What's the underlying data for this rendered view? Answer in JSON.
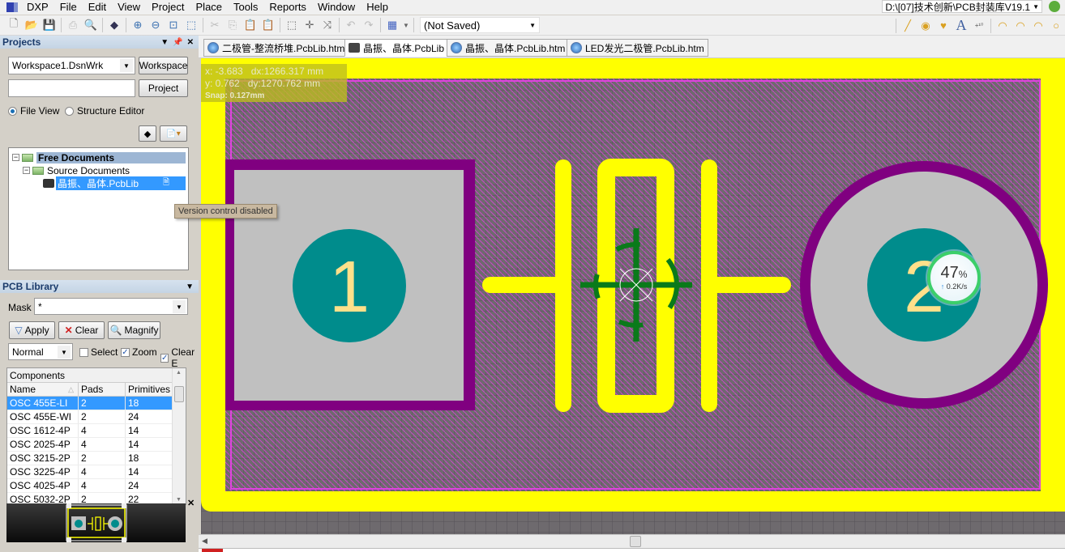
{
  "menubar": {
    "app": "DXP",
    "items": [
      "File",
      "Edit",
      "View",
      "Project",
      "Place",
      "Tools",
      "Reports",
      "Window",
      "Help"
    ],
    "path": "D:\\[07]技术创新\\PCB封装库V19.1"
  },
  "toolbar": {
    "layer_select": "(Not Saved)",
    "icons_left": [
      "new-doc",
      "open-folder",
      "save",
      "print",
      "print-preview",
      "3d-view",
      "zoom-in",
      "zoom-out",
      "zoom-fit",
      "zoom-area",
      "cut",
      "copy",
      "paste",
      "paste-special",
      "select-area",
      "move",
      "cross-probe",
      "undo",
      "redo",
      "grid"
    ],
    "icons_right": [
      "line",
      "pad",
      "via",
      "string",
      "coordinate",
      "arc-center",
      "arc-edge",
      "arc-any",
      "full-circle"
    ]
  },
  "projects_panel": {
    "title": "Projects",
    "workspace_value": "Workspace1.DsnWrk",
    "workspace_btn": "Workspace",
    "project_value": "",
    "project_btn": "Project",
    "view_options": [
      "File View",
      "Structure Editor"
    ],
    "selected_view": "File View",
    "tree": {
      "root": "Free Documents",
      "child": "Source Documents",
      "file": "晶振、晶体.PcbLib"
    },
    "tooltip": "Version control disabled"
  },
  "pcb_library": {
    "title": "PCB Library",
    "mask_label": "Mask",
    "mask_value": "*",
    "apply": "Apply",
    "clear": "Clear",
    "magnify": "Magnify",
    "mode": "Normal",
    "select_label": "Select",
    "zoom_label": "Zoom",
    "clear_existing_label": "Clear E",
    "select_checked": false,
    "zoom_checked": true,
    "clear_existing_checked": true,
    "components_title": "Components",
    "columns": [
      "Name",
      "Pads",
      "Primitives"
    ],
    "rows": [
      {
        "name": "OSC 455E-LI",
        "pads": "2",
        "prims": "18"
      },
      {
        "name": "OSC 455E-WI",
        "pads": "2",
        "prims": "24"
      },
      {
        "name": "OSC 1612-4P",
        "pads": "4",
        "prims": "14"
      },
      {
        "name": "OSC 2025-4P",
        "pads": "4",
        "prims": "14"
      },
      {
        "name": "OSC 3215-2P",
        "pads": "2",
        "prims": "18"
      },
      {
        "name": "OSC 3225-4P",
        "pads": "4",
        "prims": "14"
      },
      {
        "name": "OSC 4025-4P",
        "pads": "4",
        "prims": "24"
      },
      {
        "name": "OSC 5032-2P",
        "pads": "2",
        "prims": "22"
      }
    ],
    "selected_index": 0
  },
  "tabs": [
    {
      "label": "二极管-整流桥堆.PcbLib.htm",
      "icon": "ie"
    },
    {
      "label": "晶振、晶体.PcbLib",
      "icon": "lib",
      "active": true
    },
    {
      "label": "晶振、晶体.PcbLib.htm",
      "icon": "ie"
    },
    {
      "label": "LED发光二极管.PcbLib.htm",
      "icon": "ie"
    }
  ],
  "coords": {
    "x": "x: -3.683",
    "dx": "dx:1266.317 mm",
    "y": "y:  0.762",
    "dy": "dy:1270.762 mm",
    "snap": "Snap: 0.127mm"
  },
  "pads": [
    {
      "designator": "1"
    },
    {
      "designator": "2"
    }
  ],
  "net_meter": {
    "percent": "47",
    "unit": "%",
    "rate": "0.2K/s",
    "fraction": 0.47
  },
  "colors": {
    "keepout_yellow": "#ffff00",
    "pad_purple": "#800080",
    "pad_gray": "#c0c0c0",
    "pad_teal": "#008c8c",
    "pad_label": "#ffe08a",
    "silk_yellow": "#ffff00",
    "origin_green": "#0a7a1a"
  }
}
